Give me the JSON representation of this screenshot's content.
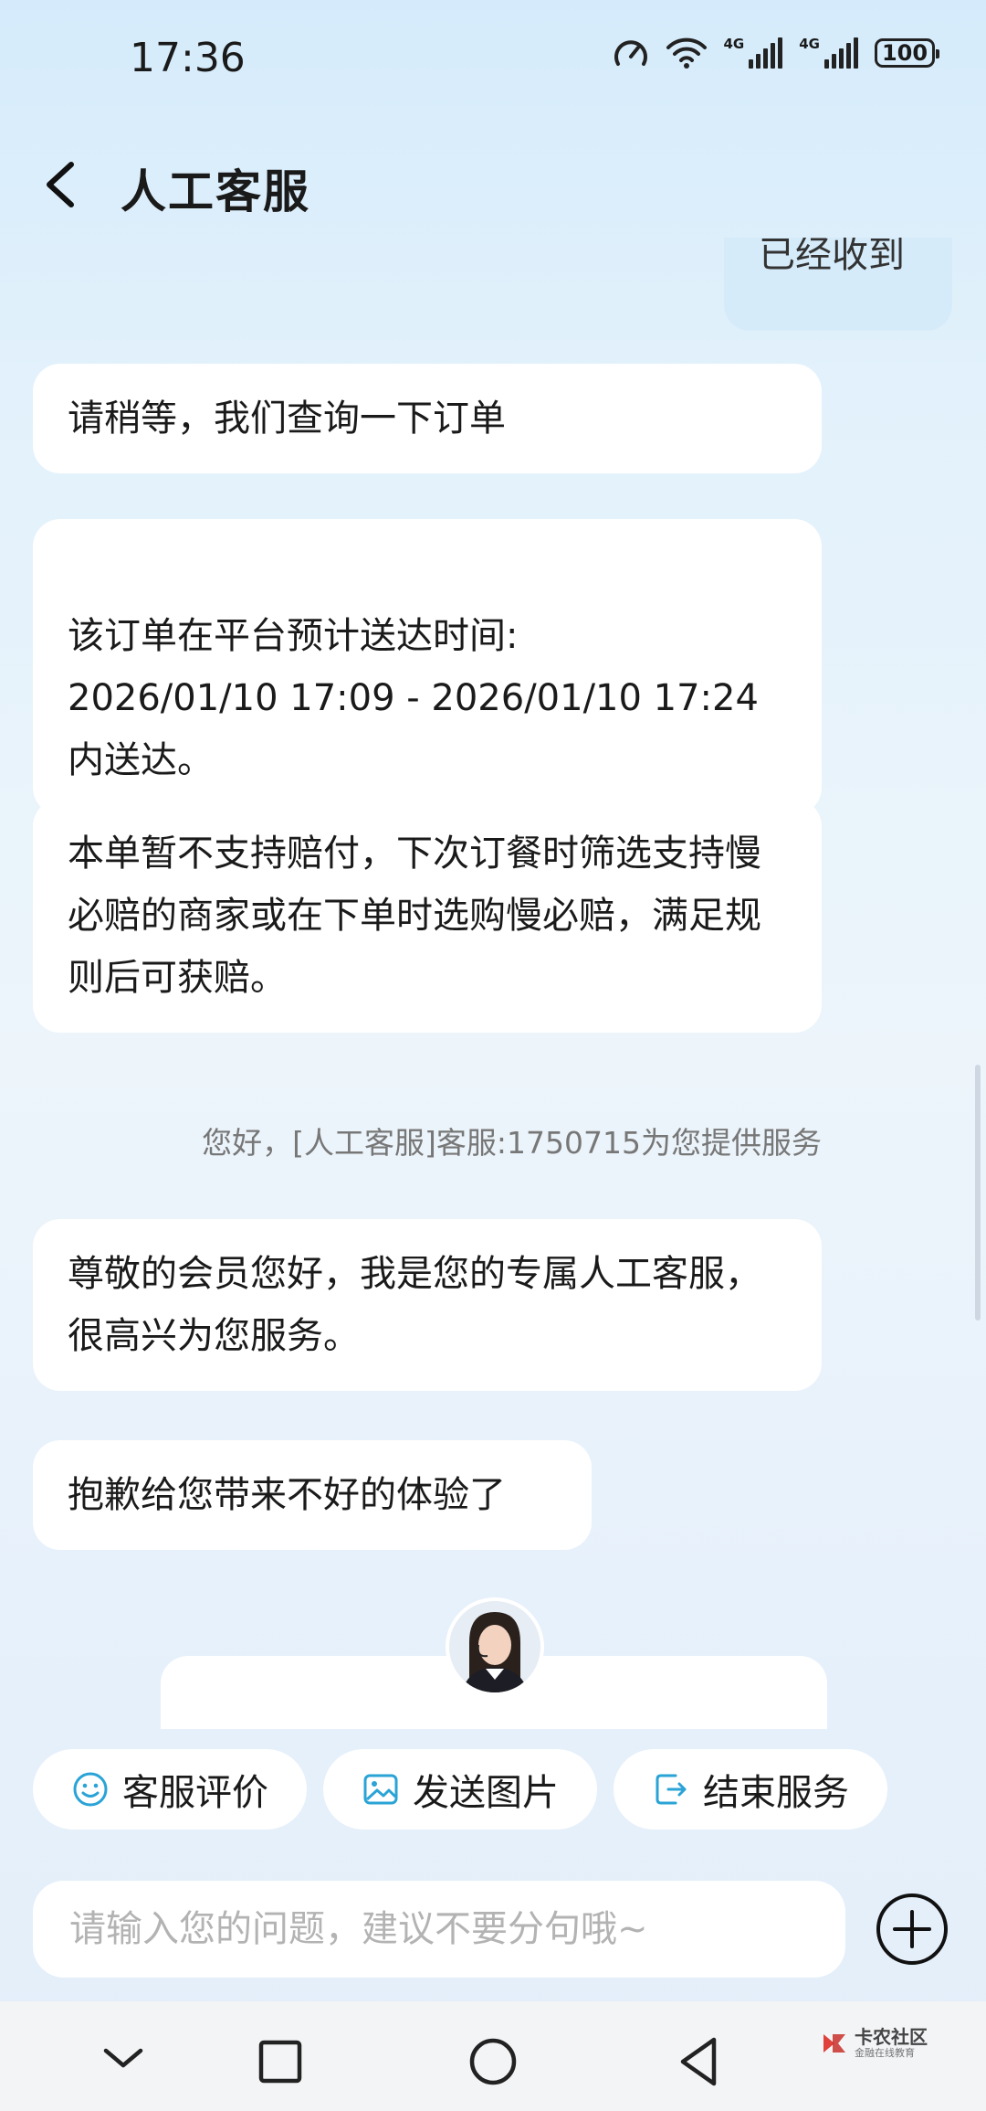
{
  "status_bar": {
    "time": "17:36",
    "battery": "100",
    "net1": "4G",
    "net2": "4G"
  },
  "header": {
    "title": "人工客服"
  },
  "messages": {
    "sent_partial": "已经收到",
    "m1": "请稍等，我们查询一下订单",
    "m2": "该订单在平台预计送达时间:\n2026/01/10 17:09 - 2026/01/10 17:24\n内送达。",
    "m3": "本单暂不支持赔付，下次订餐时筛选支持慢必赔的商家或在下单时选购慢必赔，满足规则后可获赔。",
    "system": "您好，[人工客服]客服:1750715为您提供服务",
    "m4": "尊敬的会员您好，我是您的专属人工客服，很高兴为您服务。",
    "m5": "抱歉给您带来不好的体验了"
  },
  "actions": {
    "rate": "客服评价",
    "send_image": "发送图片",
    "end_service": "结束服务"
  },
  "input": {
    "placeholder": "请输入您的问题，建议不要分句哦~"
  },
  "watermark": {
    "name": "卡农社区",
    "sub": "金融在线教育"
  },
  "colors": {
    "accent": "#2aa3d6",
    "bubble": "#ffffff",
    "sent_bubble": "#d6ebfa"
  }
}
